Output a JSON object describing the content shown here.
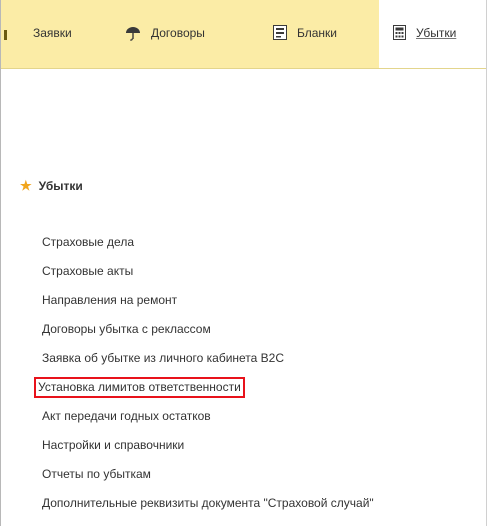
{
  "tabs": [
    {
      "label": "Заявки",
      "icon": "none"
    },
    {
      "label": "Договоры",
      "icon": "umbrella-icon"
    },
    {
      "label": "Бланки",
      "icon": "form-icon"
    },
    {
      "label": "Убытки",
      "icon": "calculator-icon",
      "active": true
    }
  ],
  "section": {
    "title": "Убытки",
    "icon": "star-icon",
    "star_color": "#f1a51c"
  },
  "menu_items": [
    {
      "label": "Страховые дела"
    },
    {
      "label": "Страховые акты"
    },
    {
      "label": "Направления на ремонт"
    },
    {
      "label": "Договоры убытка с реклассом"
    },
    {
      "label": "Заявка об убытке из личного кабинета B2C"
    },
    {
      "label": "Установка лимитов ответственности",
      "highlighted": true
    },
    {
      "label": "Акт передачи годных остатков"
    },
    {
      "label": "Настройки и справочники"
    },
    {
      "label": "Отчеты по убыткам"
    },
    {
      "label": "Дополнительные реквизиты документа \"Страховой случай\""
    }
  ],
  "colors": {
    "tabbar_bg": "#fbeca6",
    "highlight_border": "#e8121b"
  }
}
